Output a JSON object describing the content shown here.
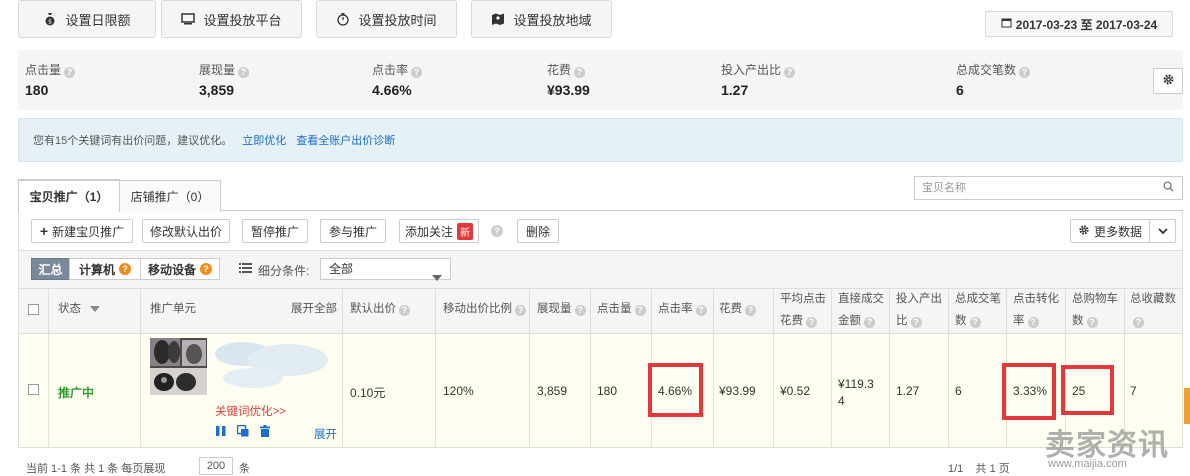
{
  "top_buttons": {
    "daily_limit": "设置日限额",
    "platform": "设置投放平台",
    "time": "设置投放时间",
    "region": "设置投放地域"
  },
  "date_range": "2017-03-23 至 2017-03-24",
  "metrics": [
    {
      "label": "点击量",
      "value": "180"
    },
    {
      "label": "展现量",
      "value": "3,859"
    },
    {
      "label": "点击率",
      "value": "4.66%"
    },
    {
      "label": "花费",
      "value": "¥93.99"
    },
    {
      "label": "投入产出比",
      "value": "1.27"
    },
    {
      "label": "总成交笔数",
      "value": "6"
    }
  ],
  "notice": {
    "text": "您有15个关键词有出价问题，建议优化。",
    "link1": "立即优化",
    "link2": "查看全账户出价诊断"
  },
  "tabs": [
    "宝贝推广（1）",
    "店铺推广（0）"
  ],
  "search_placeholder": "宝贝名称",
  "toolbar": {
    "new": "新建宝贝推广",
    "modify_bid": "修改默认出价",
    "pause": "暂停推广",
    "join": "参与推广",
    "follow": "添加关注",
    "new_badge": "新",
    "delete": "删除",
    "more_data": "更多数据"
  },
  "filter": {
    "summary": "汇总",
    "computer": "计算机",
    "mobile": "移动设备",
    "condition_label": "细分条件:",
    "condition_value": "全部"
  },
  "table": {
    "headers": {
      "status": "状态",
      "unit": "推广单元",
      "expand_all": "展开全部",
      "default_bid": "默认出价",
      "mobile_ratio": "移动出价比例",
      "impressions": "展现量",
      "clicks": "点击量",
      "ctr": "点击率",
      "cost": "花费",
      "avg_cost_1": "平均点击",
      "avg_cost_2": "花费",
      "direct_1": "直接成交",
      "direct_2": "金额",
      "roi_1": "投入产出",
      "roi_2": "比",
      "orders_1": "总成交笔",
      "orders_2": "数",
      "conv_1": "点击转化",
      "conv_2": "率",
      "cart_1": "总购物车",
      "cart_2": "数",
      "fav_1": "总收藏数"
    },
    "row": {
      "status": "推广中",
      "keyword_link": "关键词优化>>",
      "expand": "展开",
      "default_bid": "0.10元",
      "mobile_ratio": "120%",
      "impressions": "3,859",
      "clicks": "180",
      "ctr": "4.66%",
      "cost": "¥93.99",
      "avg_cost": "¥0.52",
      "direct_1": "¥119.3",
      "direct_2": "4",
      "roi": "1.27",
      "orders": "6",
      "conv": "3.33%",
      "cart": "25",
      "fav": "7"
    }
  },
  "footer": {
    "left": "当前 1-1 条  共 1 条  每页展现",
    "page_size": "200",
    "unit": "条",
    "right": "1/1    共 1 页"
  },
  "watermark": "卖家资讯",
  "watermark_url": "www.maijia.com"
}
